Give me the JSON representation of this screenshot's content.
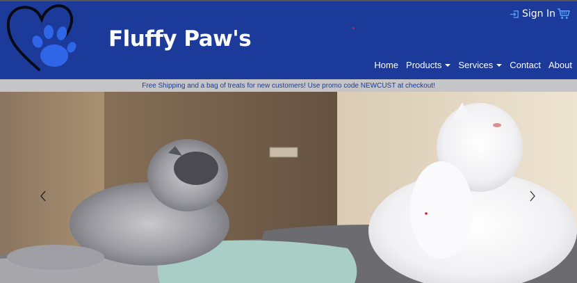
{
  "brand": {
    "name": "Fluffy Paw's",
    "logo_icon": "heart-paw-icon"
  },
  "header": {
    "signin_label": "Sign In",
    "signin_icon": "sign-in-icon",
    "cart_icon": "shopping-cart-icon"
  },
  "nav": {
    "items": [
      {
        "label": "Home",
        "dropdown": false
      },
      {
        "label": "Products",
        "dropdown": true
      },
      {
        "label": "Services",
        "dropdown": true
      },
      {
        "label": "Contact",
        "dropdown": false
      },
      {
        "label": "About",
        "dropdown": false
      }
    ]
  },
  "promo": {
    "text": "Free Shipping and a bag of treats for new customers! Use promo code NEWCUST at checkout!"
  },
  "carousel": {
    "prev_icon": "chevron-left-icon",
    "next_icon": "chevron-right-icon"
  },
  "colors": {
    "header_bg": "#1b3a9a",
    "promo_bg": "#c5c5c8",
    "promo_text": "#1b3a9a",
    "accent_paw": "#2f66e8"
  }
}
